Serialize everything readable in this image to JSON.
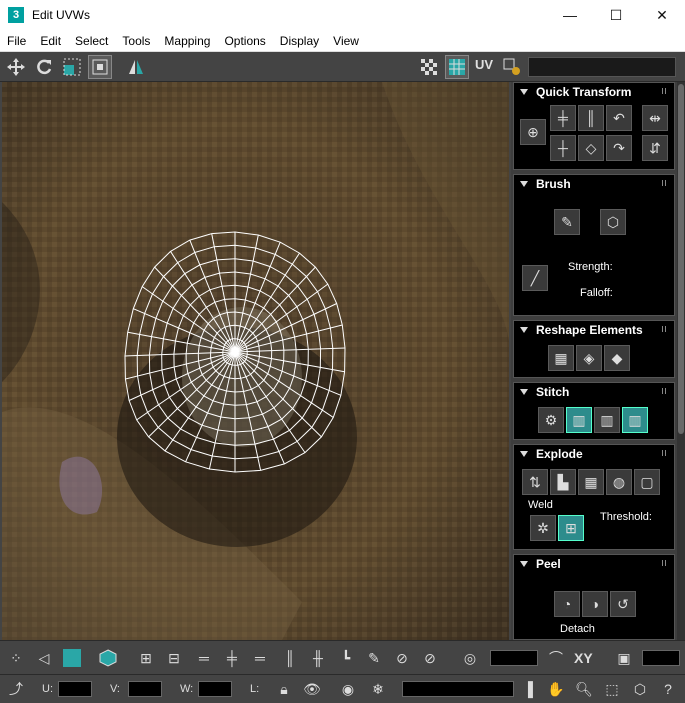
{
  "window": {
    "title": "Edit UVWs",
    "app_icon_label": "3",
    "minimize": "—",
    "maximize": "☐",
    "close": "✕"
  },
  "menu": [
    "File",
    "Edit",
    "Select",
    "Tools",
    "Mapping",
    "Options",
    "Display",
    "View"
  ],
  "toolbar": {
    "uv_label": "UV"
  },
  "panel": {
    "quick_transform": {
      "title": "Quick Transform"
    },
    "brush": {
      "title": "Brush",
      "strength_label": "Strength:",
      "falloff_label": "Falloff:"
    },
    "reshape": {
      "title": "Reshape Elements"
    },
    "stitch": {
      "title": "Stitch"
    },
    "explode": {
      "title": "Explode",
      "weld_label": "Weld",
      "threshold_label": "Threshold:"
    },
    "peel": {
      "title": "Peel",
      "detach_label": "Detach"
    }
  },
  "bottom": {
    "xy_label": "XY",
    "u_label": "U:",
    "v_label": "V:",
    "w_label": "W:",
    "l_label": "L:"
  },
  "colors": {
    "accent_teal": "#2aa7a7",
    "panel_bg": "#3e3e3e",
    "rollout_bg": "#000000"
  }
}
